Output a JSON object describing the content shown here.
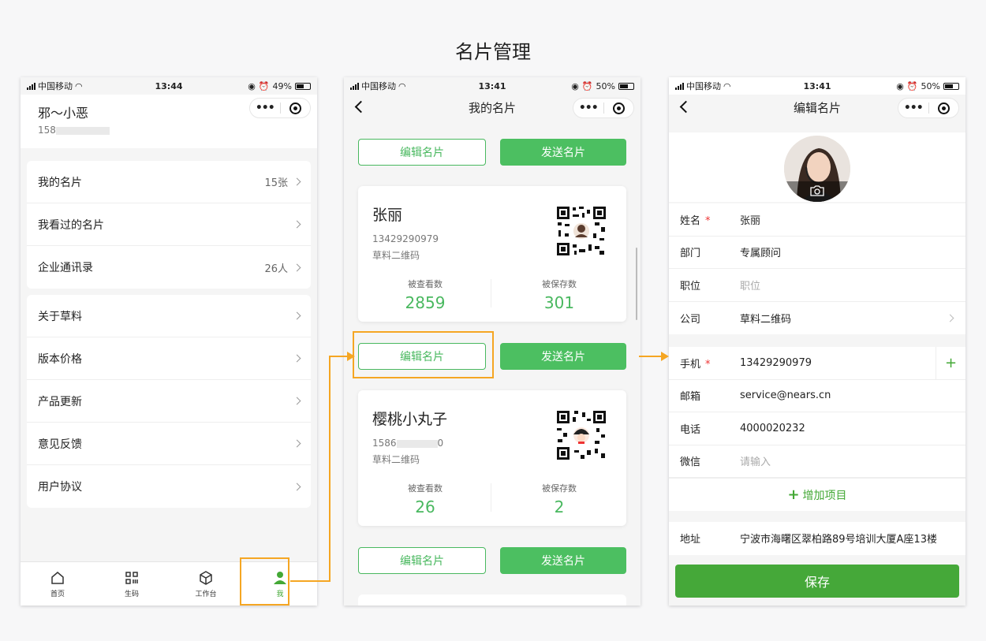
{
  "page_title": "名片管理",
  "colors": {
    "accent_green": "#4cbf61",
    "highlight_orange": "#f5a623"
  },
  "phone1": {
    "status": {
      "carrier": "中国移动",
      "time": "13:44",
      "battery": "49%"
    },
    "user": {
      "name": "邪～小恶",
      "phone": "158"
    },
    "group1": [
      {
        "label": "我的名片",
        "value": "15张"
      },
      {
        "label": "我看过的名片",
        "value": ""
      },
      {
        "label": "企业通讯录",
        "value": "26人"
      }
    ],
    "group2": [
      {
        "label": "关于草料"
      },
      {
        "label": "版本价格"
      },
      {
        "label": "产品更新"
      },
      {
        "label": "意见反馈"
      },
      {
        "label": "用户协议"
      }
    ],
    "tabs": [
      {
        "label": "首页",
        "icon": "home-icon"
      },
      {
        "label": "生码",
        "icon": "qr-grid-icon"
      },
      {
        "label": "工作台",
        "icon": "cube-icon"
      },
      {
        "label": "我",
        "icon": "user-icon"
      }
    ]
  },
  "phone2": {
    "status": {
      "carrier": "中国移动",
      "time": "13:41",
      "battery": "50%"
    },
    "title": "我的名片",
    "edit_label": "编辑名片",
    "send_label": "发送名片",
    "cards": [
      {
        "name": "张丽",
        "phone": "13429290979",
        "company": "草料二维码",
        "views_label": "被查看数",
        "views": "2859",
        "saves_label": "被保存数",
        "saves": "301"
      },
      {
        "name": "樱桃小丸子",
        "phone_prefix": "1586",
        "phone_suffix": "0",
        "company": "草料二维码",
        "views_label": "被查看数",
        "views": "26",
        "saves_label": "被保存数",
        "saves": "2"
      }
    ]
  },
  "phone3": {
    "status": {
      "carrier": "中国移动",
      "time": "13:41",
      "battery": "50%"
    },
    "title": "编辑名片",
    "fields1": [
      {
        "label": "姓名",
        "required": "*",
        "value": "张丽"
      },
      {
        "label": "部门",
        "value": "专属顾问"
      },
      {
        "label": "职位",
        "placeholder": "职位"
      },
      {
        "label": "公司",
        "value": "草料二维码"
      }
    ],
    "fields2": [
      {
        "label": "手机",
        "required": "*",
        "value": "13429290979"
      },
      {
        "label": "邮箱",
        "value": "service@nears.cn"
      },
      {
        "label": "电话",
        "value": "4000020232"
      },
      {
        "label": "微信",
        "placeholder": "请输入"
      }
    ],
    "add_item_label": "增加项目",
    "address": {
      "label": "地址",
      "value": "宁波市海曙区翠柏路89号培训大厦A座13楼"
    },
    "save_label": "保存"
  }
}
